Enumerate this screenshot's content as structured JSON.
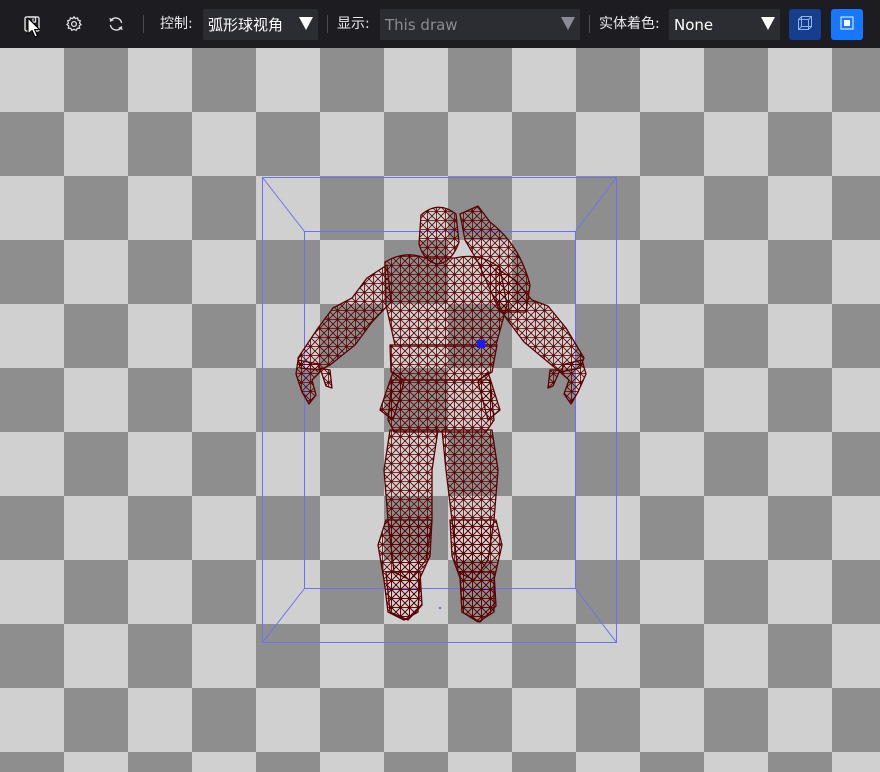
{
  "toolbar": {
    "control_label": "控制:",
    "control_value": "弧形球视角",
    "display_label": "显示:",
    "display_value": "This draw",
    "shading_label": "实体着色:",
    "shading_value": "None"
  },
  "icons": {
    "save": "save-icon",
    "settings": "gear-icon",
    "reset": "refresh-icon",
    "bounding_box": "cube-outline-icon",
    "solid": "square-solid-icon"
  },
  "colors": {
    "wireframe": "#5a0000",
    "bounding_box": "#6f6ff5",
    "accent": "#1677ff",
    "accent_dark": "#173e8c"
  }
}
